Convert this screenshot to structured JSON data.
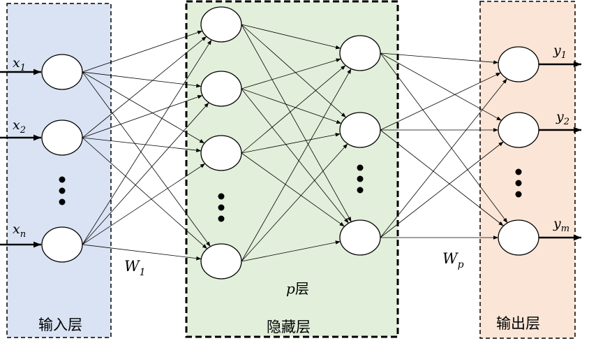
{
  "layers": {
    "input": {
      "label": "输入层",
      "fill": "#dae3f3"
    },
    "hidden": {
      "label": "隐藏层",
      "sublabel_var": "p",
      "sublabel_text": "层",
      "fill": "#e2efda"
    },
    "output": {
      "label": "输出层",
      "fill": "#fbe5d6"
    }
  },
  "inputs": [
    {
      "base": "x",
      "sub": "1"
    },
    {
      "base": "x",
      "sub": "2"
    },
    {
      "base": "x",
      "sub": "n"
    }
  ],
  "outputs": [
    {
      "base": "y",
      "sub": "1"
    },
    {
      "base": "y",
      "sub": "2"
    },
    {
      "base": "y",
      "sub": "m"
    }
  ],
  "weights": [
    {
      "base": "W",
      "sub": "1"
    },
    {
      "base": "W",
      "sub": "p"
    }
  ]
}
